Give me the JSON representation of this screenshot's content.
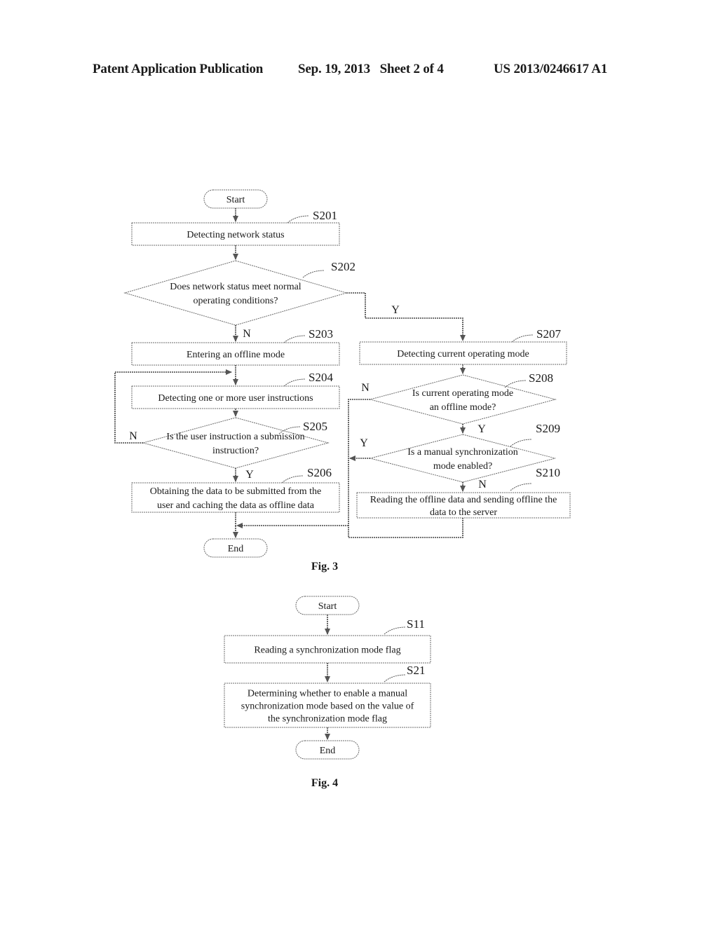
{
  "header": {
    "left": "Patent Application Publication",
    "middle": "Sep. 19, 2013   Sheet 2 of 4",
    "right": "US 2013/0246617 A1"
  },
  "fig3": {
    "caption": "Fig. 3",
    "nodes": {
      "start": "Start",
      "s201": [
        "Detecting network status"
      ],
      "s202": [
        "Does network status meet normal",
        "operating conditions?"
      ],
      "s203": [
        "Entering an offline mode"
      ],
      "s204": [
        "Detecting one or more  user instructions"
      ],
      "s205": [
        "Is the user instruction a submission",
        "instruction?"
      ],
      "s206": [
        "Obtaining the data to be submitted from the",
        "user and caching the data  as offline data"
      ],
      "s207": [
        "Detecting current operating mode"
      ],
      "s208": [
        "Is current operating mode",
        "an offline mode?"
      ],
      "s209": [
        "Is a manual synchronization",
        "mode  enabled?"
      ],
      "s210": [
        "Reading the offline data and sending offline the",
        "data to the server"
      ],
      "end": "End"
    },
    "step_labels": {
      "s201": "S201",
      "s202": "S202",
      "s203": "S203",
      "s204": "S204",
      "s205": "S205",
      "s206": "S206",
      "s207": "S207",
      "s208": "S208",
      "s209": "S209",
      "s210": "S210"
    },
    "branch_labels": {
      "s202_yes": "Y",
      "s202_no": "N",
      "s205_yes": "Y",
      "s205_no": "N",
      "s208_yes": "Y",
      "s208_no": "N",
      "s209_yes": "Y",
      "s209_no": "N"
    }
  },
  "fig4": {
    "caption": "Fig. 4",
    "nodes": {
      "start": "Start",
      "s11": [
        "Reading a synchronization mode flag"
      ],
      "s21": [
        "Determining whether to enable a manual",
        "synchronization mode based on the value of",
        "the synchronization mode flag"
      ],
      "end": "End"
    },
    "step_labels": {
      "s11": "S11",
      "s21": "S21"
    }
  }
}
